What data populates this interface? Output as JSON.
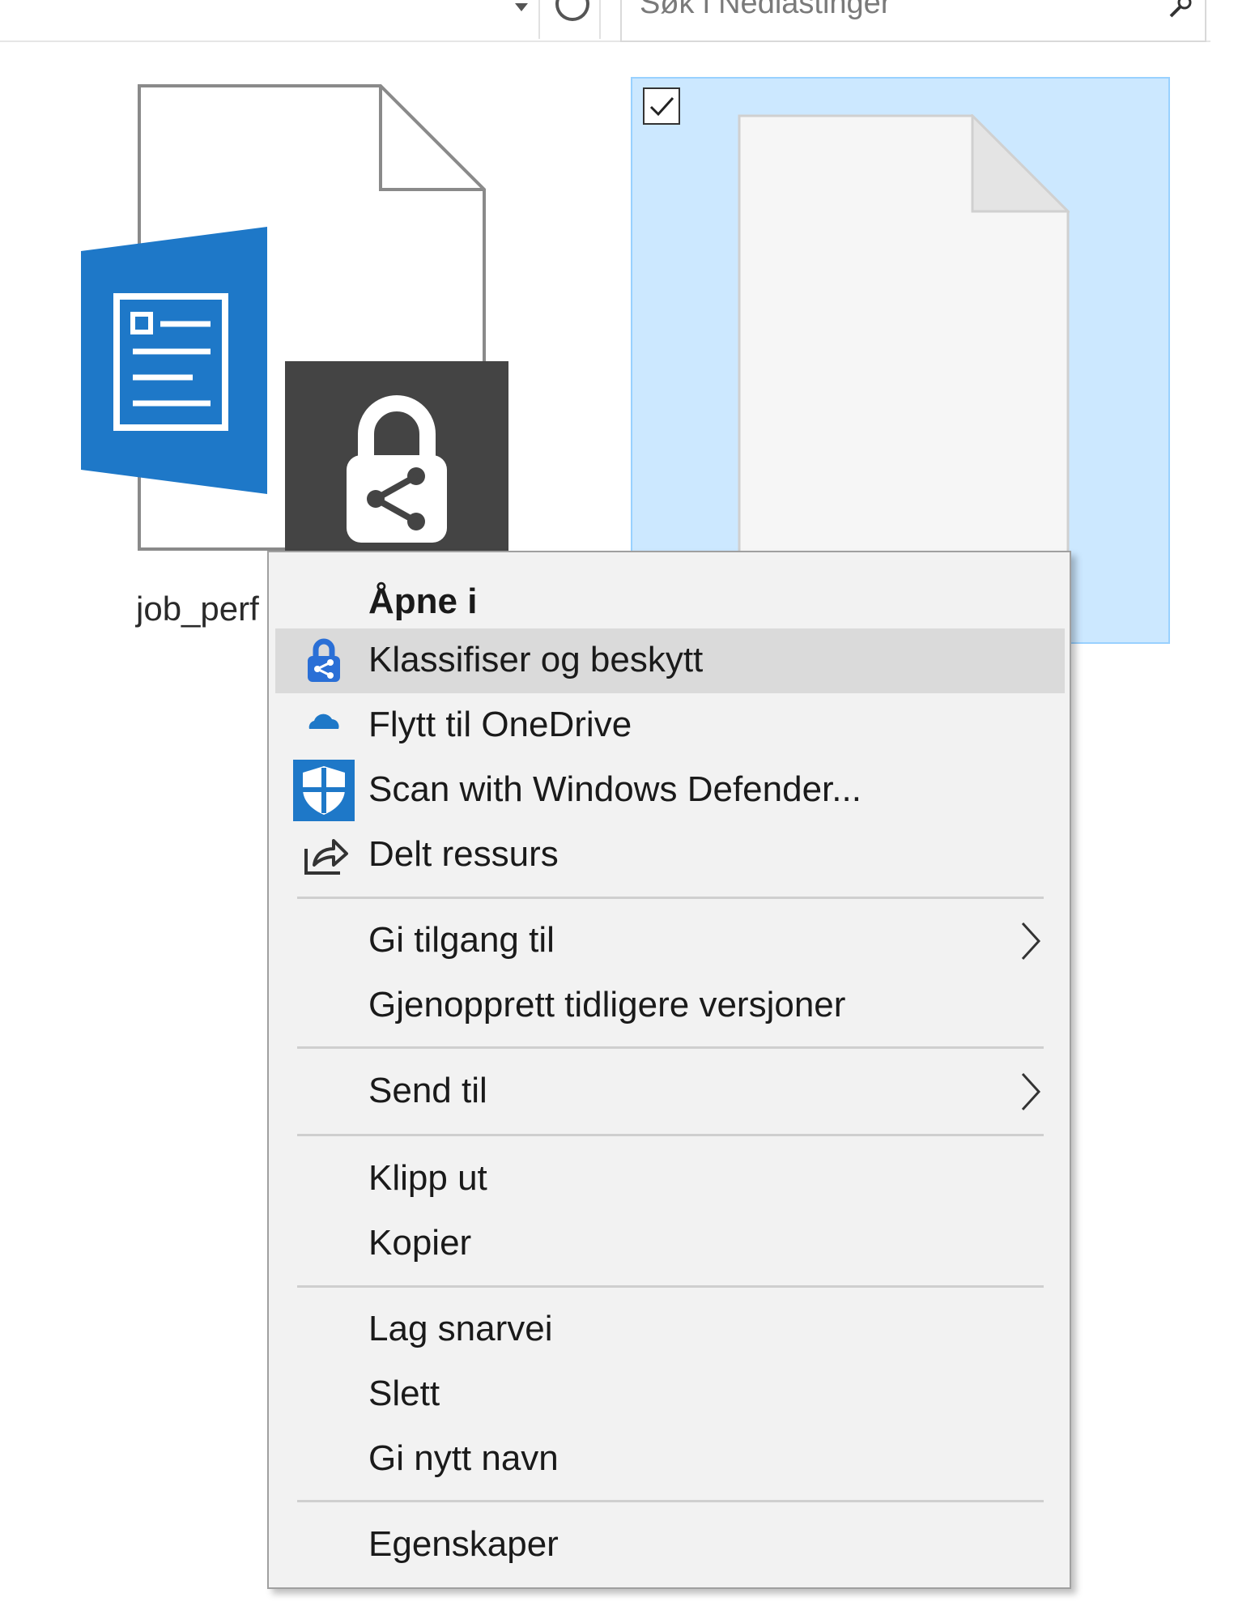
{
  "toolbar": {
    "search_placeholder": "Søk i Nedlastinger"
  },
  "files": [
    {
      "label": "job_perf",
      "selected": false,
      "icon": "word-document-protected-icon"
    },
    {
      "label": "",
      "selected": true,
      "icon": "blank-document-icon"
    }
  ],
  "context_menu": {
    "items": [
      {
        "label": "Åpne i",
        "bold": true
      },
      {
        "label": "Klassifiser og beskytt",
        "icon": "classify-protect-icon",
        "hovered": true
      },
      {
        "label": "Flytt til OneDrive",
        "icon": "onedrive-cloud-icon"
      },
      {
        "label": "Scan with Windows Defender...",
        "icon": "defender-shield-icon"
      },
      {
        "label": "Delt ressurs",
        "icon": "share-icon"
      },
      {
        "label": "Gi tilgang til",
        "submenu": true
      },
      {
        "label": "Gjenopprett tidligere versjoner"
      },
      {
        "label": "Send til",
        "submenu": true
      },
      {
        "label": "Klipp ut"
      },
      {
        "label": "Kopier"
      },
      {
        "label": "Lag snarvei"
      },
      {
        "label": "Slett"
      },
      {
        "label": "Gi nytt navn"
      },
      {
        "label": "Egenskaper"
      }
    ]
  },
  "colors": {
    "selection_fill": "#cce8ff",
    "word_blue": "#1e78c8",
    "lock_tile": "#444444",
    "menu_bg": "#f2f2f2",
    "menu_hover": "#dadada"
  }
}
